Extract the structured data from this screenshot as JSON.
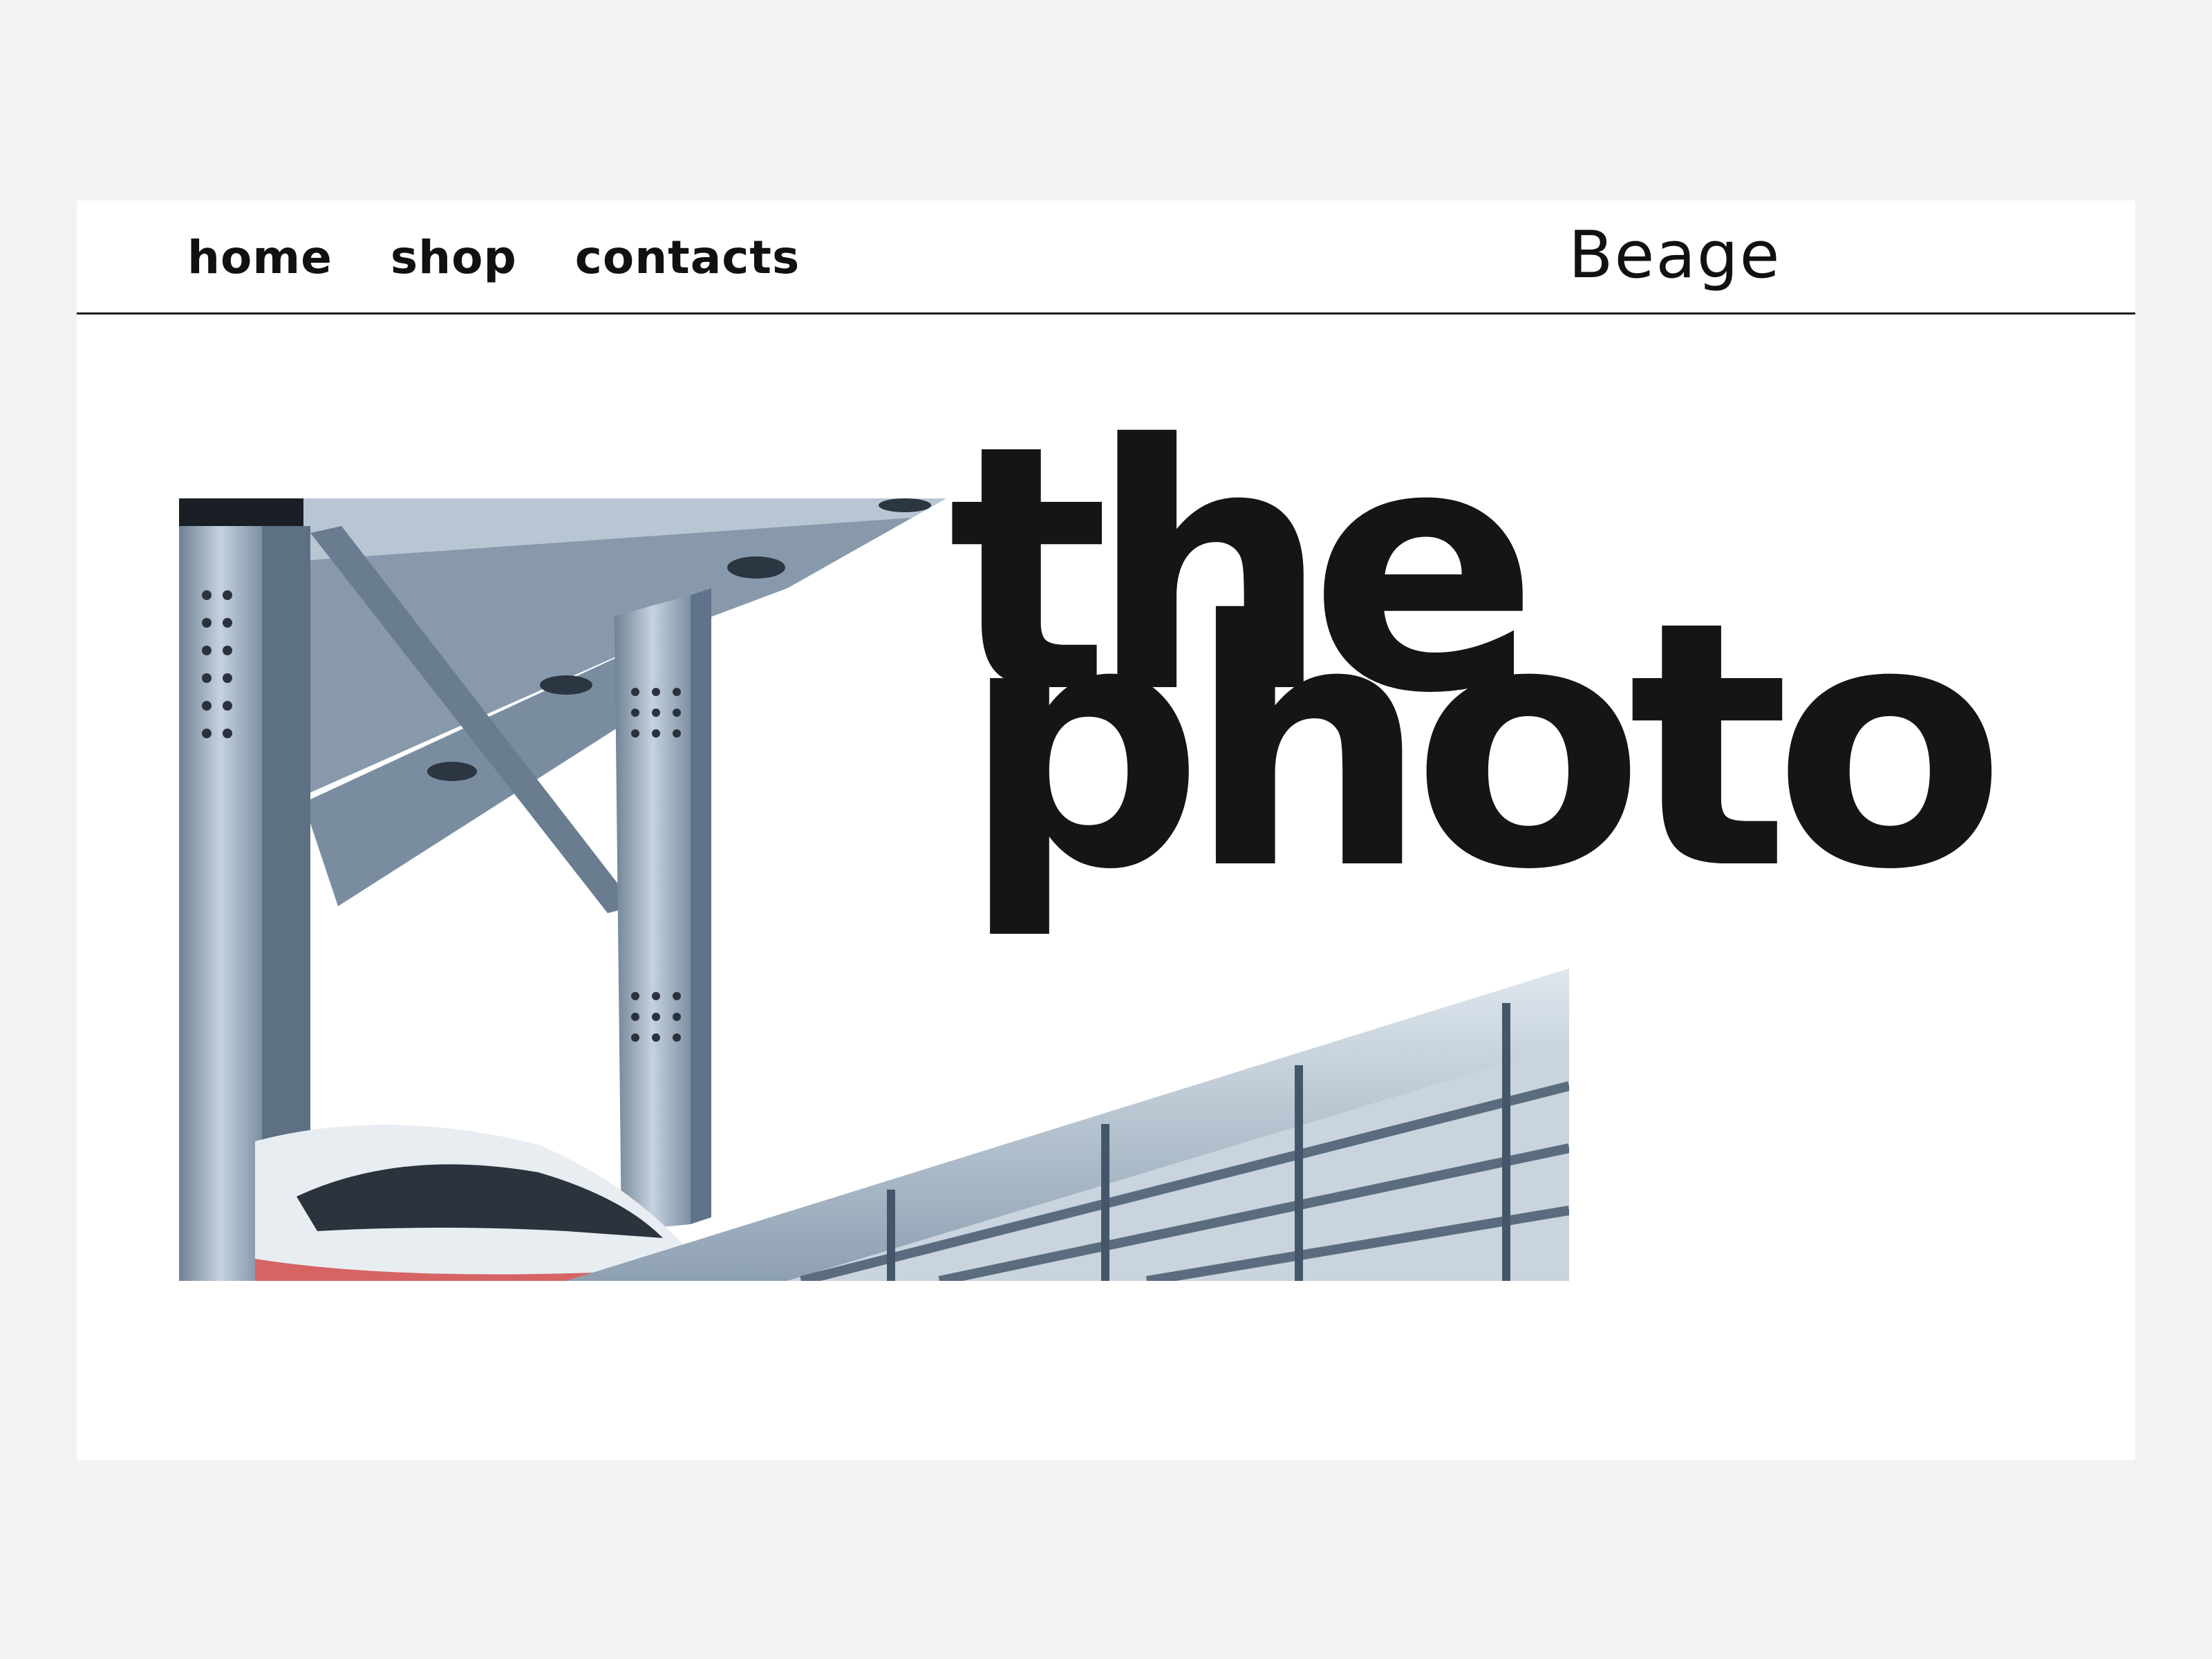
{
  "nav": {
    "links": [
      {
        "label": "home"
      },
      {
        "label": "shop"
      },
      {
        "label": "contacts"
      }
    ],
    "brand": "Beage"
  },
  "hero": {
    "title_line1": "the",
    "title_line2": "photo"
  },
  "colors": {
    "background": "#f2f2f2",
    "page": "#ffffff",
    "text": "#151515",
    "photo_steel": "#9fb0c0"
  }
}
